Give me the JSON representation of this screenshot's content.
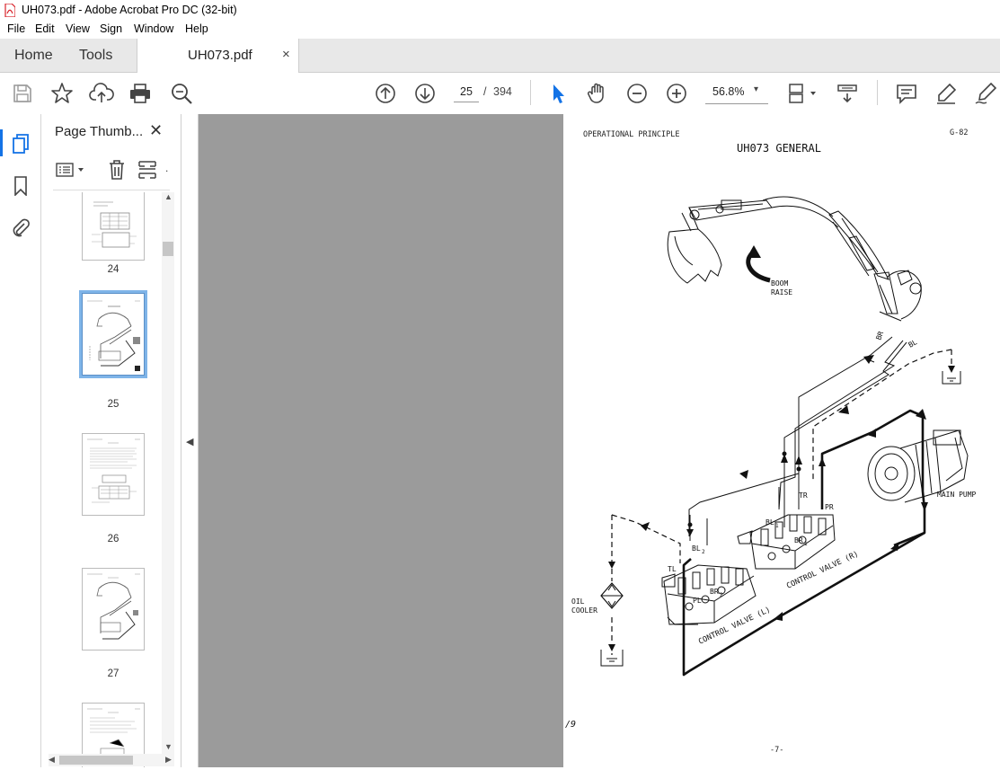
{
  "window": {
    "title": "UH073.pdf - Adobe Acrobat Pro DC (32-bit)"
  },
  "menu": [
    "File",
    "Edit",
    "View",
    "Sign",
    "Window",
    "Help"
  ],
  "tabs": {
    "home": "Home",
    "tools": "Tools",
    "document": "UH073.pdf",
    "close_glyph": "×"
  },
  "toolbar": {
    "icons": [
      "save-icon",
      "bookmark-star-icon",
      "upload-icon",
      "print-icon",
      "zoom-find-icon",
      "page-up-icon",
      "page-down-icon",
      "select-cursor-icon",
      "hand-tool-icon",
      "zoom-out-icon",
      "zoom-in-icon",
      "fit-page-icon",
      "scroll-mode-icon",
      "comment-icon",
      "highlight-icon",
      "sign-pen-icon"
    ],
    "page_current": "25",
    "page_separator": "/",
    "page_total": "394",
    "zoom": "56.8%",
    "zoom_caret": "▾"
  },
  "thumb_panel": {
    "title": "Page Thumb...",
    "close_glyph": "✕",
    "pages": [
      "24",
      "25",
      "26",
      "27"
    ],
    "selected_page": "25"
  },
  "document": {
    "header_left": "OPERATIONAL PRINCIPLE",
    "header_right": "G-82",
    "title": "UH073 GENERAL",
    "labels": {
      "boom_raise_1": "BOOM",
      "boom_raise_2": "RAISE",
      "br": "BR",
      "bl": "BL",
      "main_pump": "MAIN PUMP",
      "tr": "TR",
      "pr": "PR",
      "bl1": "BL",
      "br1": "BR",
      "bl2": "BL",
      "tl": "TL",
      "pl": "PL",
      "br2": "BR",
      "control_valve_r": "CONTROL VALVE (R)",
      "control_valve_l": "CONTROL VALVE (L)",
      "oil": "OIL",
      "cooler": "COOLER",
      "sub1": "1",
      "sub2": "2",
      "margin_mark": "/9",
      "footer": "-7-"
    }
  },
  "colors": {
    "accent": "#1473e6",
    "viewer_bg": "#9b9b9b",
    "tab_bg": "#e8e8e8",
    "selected_thumb": "#7fb4e8"
  }
}
